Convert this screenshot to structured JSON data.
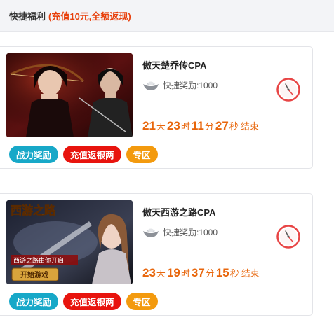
{
  "header": {
    "title": "快捷福利",
    "subtitle": "(充值10元,全额返现)"
  },
  "cards": [
    {
      "title": "傲天楚乔传CPA",
      "reward": "快捷奖励:1000",
      "timer": {
        "days": "21",
        "d_unit": "天",
        "hours": "23",
        "h_unit": "时",
        "minutes": "11",
        "m_unit": "分",
        "seconds": "27",
        "s_unit": "秒",
        "suffix": "结束"
      },
      "tags": [
        "战力奖励",
        "充值返银两",
        "专区"
      ],
      "image_icon": "drama-poster"
    },
    {
      "title": "傲天西游之路CPA",
      "reward": "快捷奖励:1000",
      "timer": {
        "days": "23",
        "d_unit": "天",
        "hours": "19",
        "h_unit": "时",
        "minutes": "37",
        "m_unit": "分",
        "seconds": "15",
        "s_unit": "秒",
        "suffix": "结束"
      },
      "tags": [
        "战力奖励",
        "充值返银两",
        "专区"
      ],
      "image_icon": "game-poster",
      "poster": {
        "logo": "西游之路",
        "tagline": "西游之路由你开启",
        "button": "开始游戏"
      }
    }
  ],
  "colors": {
    "accent": "#e8660c",
    "tag_blue": "#17a8c8",
    "tag_red": "#e8140e",
    "tag_orange": "#f39a0e"
  }
}
